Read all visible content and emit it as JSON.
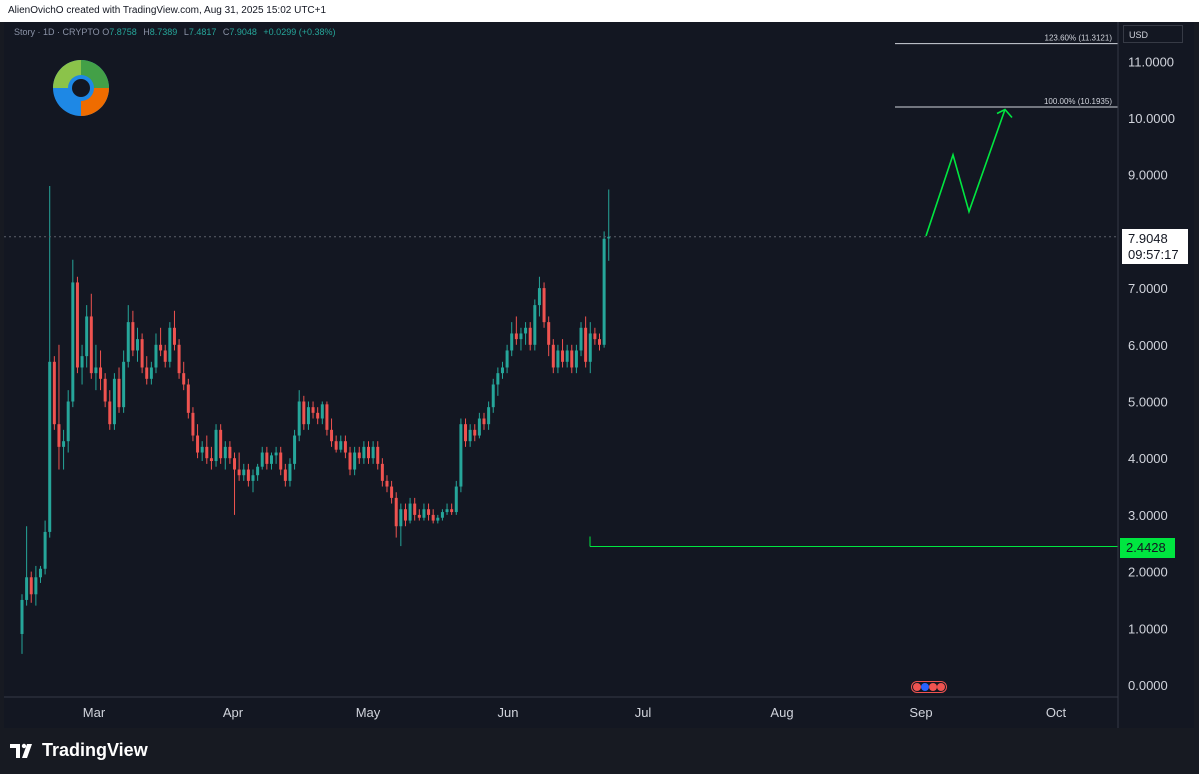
{
  "header": {
    "text": "AlienOvichO created with TradingView.com, Aug 31, 2025 15:02 UTC+1"
  },
  "legend": {
    "symbol": "Story · 1D · CRYPTO",
    "open_key": "O",
    "open": "7.8758",
    "high_key": "H",
    "high": "8.7389",
    "low_key": "L",
    "low": "7.4817",
    "close_key": "C",
    "close": "7.9048",
    "change": "+0.0299 (+0.38%)"
  },
  "price_scale": {
    "currency": "USD",
    "labels": [
      "11.0000",
      "10.0000",
      "9.0000",
      "7.0000",
      "6.0000",
      "5.0000",
      "4.0000",
      "3.0000",
      "2.0000",
      "1.0000",
      "0.0000"
    ]
  },
  "last_price": {
    "price": "7.9048",
    "countdown": "09:57:17"
  },
  "support": {
    "price": "2.4428",
    "color": "#00e640"
  },
  "fib_levels": [
    {
      "label": "123.60% (11.3121)",
      "price": 11.3121
    },
    {
      "label": "100.00% (10.1935)",
      "price": 10.1935
    }
  ],
  "time_axis": {
    "labels": [
      "Mar",
      "Apr",
      "May",
      "Jun",
      "Jul",
      "Aug",
      "Sep",
      "Oct"
    ]
  },
  "footer": {
    "brand": "TradingView"
  },
  "colors": {
    "up": "#26a69a",
    "down": "#ef5350",
    "projection": "#00e640",
    "background": "#131722"
  },
  "chart_data": {
    "type": "candlestick",
    "ylim": [
      0,
      11.5
    ],
    "projection_path_prices": [
      7.92,
      9.35,
      8.35,
      10.15
    ],
    "series": [
      {
        "o": 0.9,
        "h": 1.6,
        "l": 0.55,
        "c": 1.5
      },
      {
        "o": 1.5,
        "h": 2.8,
        "l": 1.4,
        "c": 1.9
      },
      {
        "o": 1.9,
        "h": 2.0,
        "l": 1.45,
        "c": 1.6
      },
      {
        "o": 1.6,
        "h": 2.1,
        "l": 1.4,
        "c": 1.9
      },
      {
        "o": 1.9,
        "h": 2.1,
        "l": 1.8,
        "c": 2.05
      },
      {
        "o": 2.05,
        "h": 2.9,
        "l": 1.95,
        "c": 2.7
      },
      {
        "o": 2.7,
        "h": 8.8,
        "l": 2.6,
        "c": 5.7
      },
      {
        "o": 5.7,
        "h": 5.8,
        "l": 4.5,
        "c": 4.6
      },
      {
        "o": 4.6,
        "h": 6.0,
        "l": 3.8,
        "c": 4.2
      },
      {
        "o": 4.2,
        "h": 4.5,
        "l": 3.8,
        "c": 4.3
      },
      {
        "o": 4.3,
        "h": 5.2,
        "l": 4.1,
        "c": 5.0
      },
      {
        "o": 5.0,
        "h": 7.5,
        "l": 4.9,
        "c": 7.1
      },
      {
        "o": 7.1,
        "h": 7.2,
        "l": 5.5,
        "c": 5.6
      },
      {
        "o": 5.6,
        "h": 6.0,
        "l": 5.3,
        "c": 5.8
      },
      {
        "o": 5.8,
        "h": 6.7,
        "l": 5.6,
        "c": 6.5
      },
      {
        "o": 6.5,
        "h": 6.9,
        "l": 5.4,
        "c": 5.5
      },
      {
        "o": 5.5,
        "h": 6.0,
        "l": 5.2,
        "c": 5.6
      },
      {
        "o": 5.6,
        "h": 5.9,
        "l": 5.2,
        "c": 5.4
      },
      {
        "o": 5.4,
        "h": 5.5,
        "l": 4.9,
        "c": 5.0
      },
      {
        "o": 5.0,
        "h": 5.2,
        "l": 4.5,
        "c": 4.6
      },
      {
        "o": 4.6,
        "h": 5.5,
        "l": 4.5,
        "c": 5.4
      },
      {
        "o": 5.4,
        "h": 5.6,
        "l": 4.8,
        "c": 4.9
      },
      {
        "o": 4.9,
        "h": 5.9,
        "l": 4.8,
        "c": 5.7
      },
      {
        "o": 5.7,
        "h": 6.7,
        "l": 5.6,
        "c": 6.4
      },
      {
        "o": 6.4,
        "h": 6.6,
        "l": 5.8,
        "c": 5.9
      },
      {
        "o": 5.9,
        "h": 6.3,
        "l": 5.7,
        "c": 6.1
      },
      {
        "o": 6.1,
        "h": 6.2,
        "l": 5.5,
        "c": 5.6
      },
      {
        "o": 5.6,
        "h": 5.8,
        "l": 5.3,
        "c": 5.4
      },
      {
        "o": 5.4,
        "h": 5.7,
        "l": 5.3,
        "c": 5.6
      },
      {
        "o": 5.6,
        "h": 6.2,
        "l": 5.5,
        "c": 6.0
      },
      {
        "o": 6.0,
        "h": 6.3,
        "l": 5.8,
        "c": 5.9
      },
      {
        "o": 5.9,
        "h": 6.0,
        "l": 5.6,
        "c": 5.7
      },
      {
        "o": 5.7,
        "h": 6.4,
        "l": 5.6,
        "c": 6.3
      },
      {
        "o": 6.3,
        "h": 6.6,
        "l": 5.9,
        "c": 6.0
      },
      {
        "o": 6.0,
        "h": 6.1,
        "l": 5.4,
        "c": 5.5
      },
      {
        "o": 5.5,
        "h": 5.7,
        "l": 5.2,
        "c": 5.3
      },
      {
        "o": 5.3,
        "h": 5.4,
        "l": 4.7,
        "c": 4.8
      },
      {
        "o": 4.8,
        "h": 4.9,
        "l": 4.3,
        "c": 4.4
      },
      {
        "o": 4.4,
        "h": 4.6,
        "l": 4.0,
        "c": 4.1
      },
      {
        "o": 4.1,
        "h": 4.3,
        "l": 3.95,
        "c": 4.2
      },
      {
        "o": 4.2,
        "h": 4.4,
        "l": 3.9,
        "c": 4.0
      },
      {
        "o": 4.0,
        "h": 4.2,
        "l": 3.8,
        "c": 3.95
      },
      {
        "o": 3.95,
        "h": 4.6,
        "l": 3.85,
        "c": 4.5
      },
      {
        "o": 4.5,
        "h": 4.6,
        "l": 3.9,
        "c": 4.0
      },
      {
        "o": 4.0,
        "h": 4.3,
        "l": 3.8,
        "c": 4.2
      },
      {
        "o": 4.2,
        "h": 4.3,
        "l": 3.9,
        "c": 4.0
      },
      {
        "o": 4.0,
        "h": 4.1,
        "l": 3.0,
        "c": 3.8
      },
      {
        "o": 3.8,
        "h": 4.1,
        "l": 3.6,
        "c": 3.7
      },
      {
        "o": 3.7,
        "h": 3.9,
        "l": 3.6,
        "c": 3.8
      },
      {
        "o": 3.8,
        "h": 3.9,
        "l": 3.5,
        "c": 3.6
      },
      {
        "o": 3.6,
        "h": 3.8,
        "l": 3.4,
        "c": 3.7
      },
      {
        "o": 3.7,
        "h": 3.9,
        "l": 3.6,
        "c": 3.85
      },
      {
        "o": 3.85,
        "h": 4.2,
        "l": 3.8,
        "c": 4.1
      },
      {
        "o": 4.1,
        "h": 4.2,
        "l": 3.8,
        "c": 3.9
      },
      {
        "o": 3.9,
        "h": 4.1,
        "l": 3.8,
        "c": 4.05
      },
      {
        "o": 4.05,
        "h": 4.2,
        "l": 3.9,
        "c": 4.1
      },
      {
        "o": 4.1,
        "h": 4.2,
        "l": 3.7,
        "c": 3.8
      },
      {
        "o": 3.8,
        "h": 3.9,
        "l": 3.5,
        "c": 3.6
      },
      {
        "o": 3.6,
        "h": 4.0,
        "l": 3.5,
        "c": 3.9
      },
      {
        "o": 3.9,
        "h": 4.5,
        "l": 3.8,
        "c": 4.4
      },
      {
        "o": 4.4,
        "h": 5.2,
        "l": 4.3,
        "c": 5.0
      },
      {
        "o": 5.0,
        "h": 5.1,
        "l": 4.5,
        "c": 4.6
      },
      {
        "o": 4.6,
        "h": 5.0,
        "l": 4.5,
        "c": 4.9
      },
      {
        "o": 4.9,
        "h": 5.0,
        "l": 4.7,
        "c": 4.8
      },
      {
        "o": 4.8,
        "h": 4.9,
        "l": 4.6,
        "c": 4.7
      },
      {
        "o": 4.7,
        "h": 5.0,
        "l": 4.6,
        "c": 4.95
      },
      {
        "o": 4.95,
        "h": 5.0,
        "l": 4.4,
        "c": 4.5
      },
      {
        "o": 4.5,
        "h": 4.7,
        "l": 4.2,
        "c": 4.3
      },
      {
        "o": 4.3,
        "h": 4.4,
        "l": 4.1,
        "c": 4.15
      },
      {
        "o": 4.15,
        "h": 4.4,
        "l": 4.1,
        "c": 4.3
      },
      {
        "o": 4.3,
        "h": 4.4,
        "l": 4.0,
        "c": 4.1
      },
      {
        "o": 4.1,
        "h": 4.2,
        "l": 3.7,
        "c": 3.8
      },
      {
        "o": 3.8,
        "h": 4.2,
        "l": 3.7,
        "c": 4.1
      },
      {
        "o": 4.1,
        "h": 4.2,
        "l": 3.9,
        "c": 4.0
      },
      {
        "o": 4.0,
        "h": 4.3,
        "l": 3.9,
        "c": 4.2
      },
      {
        "o": 4.2,
        "h": 4.3,
        "l": 3.9,
        "c": 4.0
      },
      {
        "o": 4.0,
        "h": 4.3,
        "l": 3.9,
        "c": 4.2
      },
      {
        "o": 4.2,
        "h": 4.3,
        "l": 3.8,
        "c": 3.9
      },
      {
        "o": 3.9,
        "h": 4.0,
        "l": 3.5,
        "c": 3.6
      },
      {
        "o": 3.6,
        "h": 3.7,
        "l": 3.4,
        "c": 3.5
      },
      {
        "o": 3.5,
        "h": 3.6,
        "l": 3.2,
        "c": 3.3
      },
      {
        "o": 3.3,
        "h": 3.4,
        "l": 2.6,
        "c": 2.8
      },
      {
        "o": 2.8,
        "h": 3.2,
        "l": 2.45,
        "c": 3.1
      },
      {
        "o": 3.1,
        "h": 3.2,
        "l": 2.8,
        "c": 2.9
      },
      {
        "o": 2.9,
        "h": 3.3,
        "l": 2.85,
        "c": 3.2
      },
      {
        "o": 3.2,
        "h": 3.3,
        "l": 2.9,
        "c": 3.0
      },
      {
        "o": 3.0,
        "h": 3.1,
        "l": 2.9,
        "c": 2.95
      },
      {
        "o": 2.95,
        "h": 3.2,
        "l": 2.9,
        "c": 3.1
      },
      {
        "o": 3.1,
        "h": 3.2,
        "l": 2.9,
        "c": 3.0
      },
      {
        "o": 3.0,
        "h": 3.1,
        "l": 2.85,
        "c": 2.9
      },
      {
        "o": 2.9,
        "h": 3.0,
        "l": 2.85,
        "c": 2.95
      },
      {
        "o": 2.95,
        "h": 3.1,
        "l": 2.9,
        "c": 3.05
      },
      {
        "o": 3.05,
        "h": 3.2,
        "l": 3.0,
        "c": 3.1
      },
      {
        "o": 3.1,
        "h": 3.2,
        "l": 3.0,
        "c": 3.05
      },
      {
        "o": 3.05,
        "h": 3.6,
        "l": 3.0,
        "c": 3.5
      },
      {
        "o": 3.5,
        "h": 4.7,
        "l": 3.4,
        "c": 4.6
      },
      {
        "o": 4.6,
        "h": 4.7,
        "l": 4.2,
        "c": 4.3
      },
      {
        "o": 4.3,
        "h": 4.6,
        "l": 4.2,
        "c": 4.5
      },
      {
        "o": 4.5,
        "h": 4.6,
        "l": 4.3,
        "c": 4.4
      },
      {
        "o": 4.4,
        "h": 4.8,
        "l": 4.35,
        "c": 4.7
      },
      {
        "o": 4.7,
        "h": 4.8,
        "l": 4.5,
        "c": 4.6
      },
      {
        "o": 4.6,
        "h": 5.0,
        "l": 4.5,
        "c": 4.9
      },
      {
        "o": 4.9,
        "h": 5.4,
        "l": 4.8,
        "c": 5.3
      },
      {
        "o": 5.3,
        "h": 5.6,
        "l": 5.1,
        "c": 5.5
      },
      {
        "o": 5.5,
        "h": 5.7,
        "l": 5.4,
        "c": 5.6
      },
      {
        "o": 5.6,
        "h": 6.0,
        "l": 5.5,
        "c": 5.9
      },
      {
        "o": 5.9,
        "h": 6.4,
        "l": 5.8,
        "c": 6.2
      },
      {
        "o": 6.2,
        "h": 6.5,
        "l": 6.0,
        "c": 6.1
      },
      {
        "o": 6.1,
        "h": 6.3,
        "l": 5.9,
        "c": 6.2
      },
      {
        "o": 6.2,
        "h": 6.4,
        "l": 6.0,
        "c": 6.3
      },
      {
        "o": 6.3,
        "h": 6.4,
        "l": 5.9,
        "c": 6.0
      },
      {
        "o": 6.0,
        "h": 6.8,
        "l": 5.9,
        "c": 6.7
      },
      {
        "o": 6.7,
        "h": 7.2,
        "l": 6.5,
        "c": 7.0
      },
      {
        "o": 7.0,
        "h": 7.1,
        "l": 6.3,
        "c": 6.4
      },
      {
        "o": 6.4,
        "h": 6.5,
        "l": 5.8,
        "c": 6.0
      },
      {
        "o": 6.0,
        "h": 6.1,
        "l": 5.5,
        "c": 5.6
      },
      {
        "o": 5.6,
        "h": 6.0,
        "l": 5.5,
        "c": 5.9
      },
      {
        "o": 5.9,
        "h": 6.1,
        "l": 5.6,
        "c": 5.7
      },
      {
        "o": 5.7,
        "h": 6.0,
        "l": 5.6,
        "c": 5.9
      },
      {
        "o": 5.9,
        "h": 6.0,
        "l": 5.5,
        "c": 5.6
      },
      {
        "o": 5.6,
        "h": 6.0,
        "l": 5.5,
        "c": 5.9
      },
      {
        "o": 5.9,
        "h": 6.4,
        "l": 5.8,
        "c": 6.3
      },
      {
        "o": 6.3,
        "h": 6.5,
        "l": 5.6,
        "c": 5.7
      },
      {
        "o": 5.7,
        "h": 6.4,
        "l": 5.5,
        "c": 6.2
      },
      {
        "o": 6.2,
        "h": 6.3,
        "l": 6.0,
        "c": 6.1
      },
      {
        "o": 6.1,
        "h": 6.2,
        "l": 5.9,
        "c": 6.0
      },
      {
        "o": 6.0,
        "h": 8.0,
        "l": 5.95,
        "c": 7.87
      },
      {
        "o": 7.8758,
        "h": 8.7389,
        "l": 7.4817,
        "c": 7.9048
      }
    ]
  }
}
